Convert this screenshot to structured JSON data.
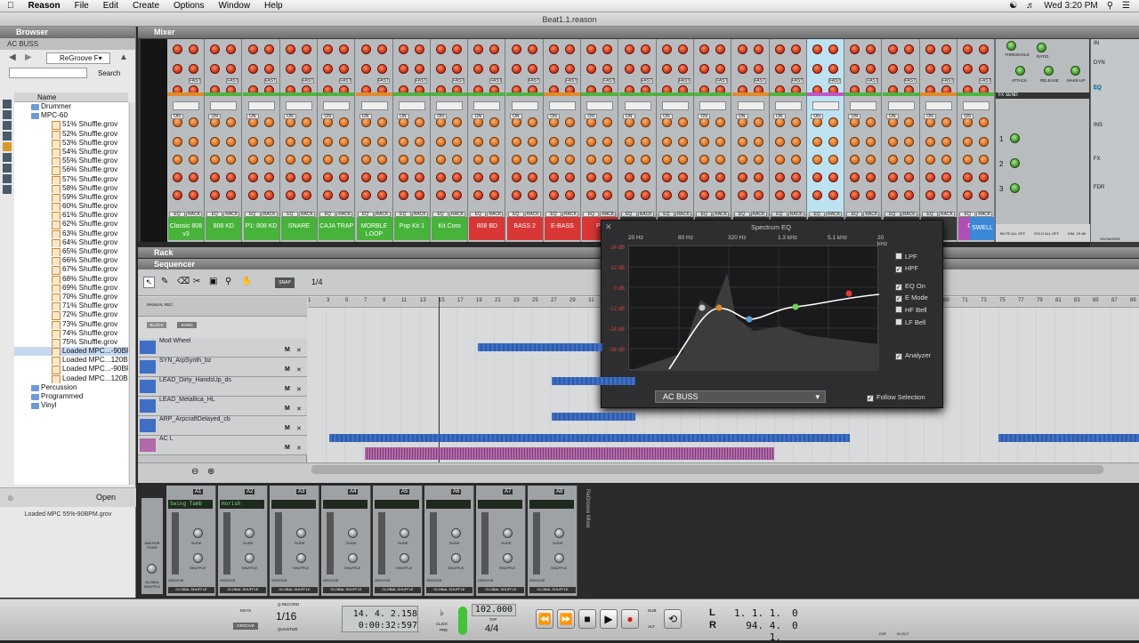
{
  "menubar": {
    "app": "Reason",
    "items": [
      "File",
      "Edit",
      "Create",
      "Options",
      "Window",
      "Help"
    ],
    "clock": "Wed 3:20 PM"
  },
  "window": {
    "title": "Beat1.1.reason"
  },
  "browser": {
    "title": "Browser",
    "location": "AC BUSS",
    "dropdown": "ReGroove F▾",
    "search_button": "Search",
    "column_name": "Name",
    "tree": [
      {
        "label": "Drummer",
        "kind": "folder"
      },
      {
        "label": "MPC-60",
        "kind": "folder"
      },
      {
        "label": "51% Shuffle.grov",
        "kind": "file"
      },
      {
        "label": "52% Shuffle.grov",
        "kind": "file"
      },
      {
        "label": "53% Shuffle.grov",
        "kind": "file"
      },
      {
        "label": "54% Shuffle.grov",
        "kind": "file"
      },
      {
        "label": "55% Shuffle.grov",
        "kind": "file"
      },
      {
        "label": "56% Shuffle.grov",
        "kind": "file"
      },
      {
        "label": "57% Shuffle.grov",
        "kind": "file"
      },
      {
        "label": "58% Shuffle.grov",
        "kind": "file"
      },
      {
        "label": "59% Shuffle.grov",
        "kind": "file"
      },
      {
        "label": "60% Shuffle.grov",
        "kind": "file"
      },
      {
        "label": "61% Shuffle.grov",
        "kind": "file"
      },
      {
        "label": "62% Shuffle.grov",
        "kind": "file"
      },
      {
        "label": "63% Shuffle.grov",
        "kind": "file"
      },
      {
        "label": "64% Shuffle.grov",
        "kind": "file"
      },
      {
        "label": "65% Shuffle.grov",
        "kind": "file"
      },
      {
        "label": "66% Shuffle.grov",
        "kind": "file"
      },
      {
        "label": "67% Shuffle.grov",
        "kind": "file"
      },
      {
        "label": "68% Shuffle.grov",
        "kind": "file"
      },
      {
        "label": "69% Shuffle.grov",
        "kind": "file"
      },
      {
        "label": "70% Shuffle.grov",
        "kind": "file"
      },
      {
        "label": "71% Shuffle.grov",
        "kind": "file"
      },
      {
        "label": "72% Shuffle.grov",
        "kind": "file"
      },
      {
        "label": "73% Shuffle.grov",
        "kind": "file"
      },
      {
        "label": "74% Shuffle.grov",
        "kind": "file"
      },
      {
        "label": "75% Shuffle.grov",
        "kind": "file"
      },
      {
        "label": "Loaded MPC...-90BPM.grov",
        "kind": "file",
        "selected": true
      },
      {
        "label": "Loaded MPC...120BPM.grov",
        "kind": "file"
      },
      {
        "label": "Loaded MPC...-90BPM.grov",
        "kind": "file"
      },
      {
        "label": "Loaded MPC...120BPM.grov",
        "kind": "file"
      },
      {
        "label": "Percussion",
        "kind": "folder"
      },
      {
        "label": "Programmed",
        "kind": "folder"
      },
      {
        "label": "Vinyl",
        "kind": "folder"
      }
    ],
    "open_button": "Open",
    "status": "Loaded MPC 55%-90BPM.grov"
  },
  "mixer": {
    "title": "Mixer",
    "channels": [
      {
        "name": "Classic 808 v3",
        "color": "#47b33a"
      },
      {
        "name": "808 KD",
        "color": "#47b33a"
      },
      {
        "name": "P1: 808 KD",
        "color": "#47b33a"
      },
      {
        "name": "SNARE",
        "color": "#47b33a"
      },
      {
        "name": "CAJA TRAP",
        "color": "#47b33a"
      },
      {
        "name": "MORBLE LOOP",
        "color": "#47b33a"
      },
      {
        "name": "Pop Kit 1",
        "color": "#47b33a"
      },
      {
        "name": "Kit Coro",
        "color": "#47b33a"
      },
      {
        "name": "808 BD",
        "color": "#d93636"
      },
      {
        "name": "BASS 2",
        "color": "#d93636"
      },
      {
        "name": "E-BASS",
        "color": "#d93636"
      },
      {
        "name": "P1",
        "color": "#d93636"
      },
      {
        "name": "",
        "color": "#3a3a3a"
      },
      {
        "name": "",
        "color": "#3a3a3a"
      },
      {
        "name": "",
        "color": "#3a3a3a"
      },
      {
        "name": "",
        "color": "#3a3a3a"
      },
      {
        "name": "",
        "color": "#3a3a3a"
      },
      {
        "name": "",
        "color": "#3a3a3a"
      },
      {
        "name": "",
        "color": "#3a3a3a"
      },
      {
        "name": "",
        "color": "#3a3a3a"
      },
      {
        "name": "",
        "color": "#3a3a3a"
      },
      {
        "name": "OPUS",
        "color": "#b04fb5"
      }
    ],
    "swell_label": "SWELL",
    "knob_labels": {
      "on": "ON",
      "fast": "FAST",
      "eq": "EQ",
      "rack": "RACK"
    },
    "master_labels": [
      "THRESHOLD",
      "RATIO",
      "ATTACK",
      "RELEASE",
      "MAKE-UP",
      "FX SEND"
    ],
    "side_tabs": [
      "IN",
      "DYN",
      "EQ",
      "INS",
      "FX",
      "FDR"
    ],
    "fx_rows": [
      "1",
      "2",
      "3"
    ],
    "bottom_labels": [
      "MUTE ALL OFF",
      "SOLO ALL OFF",
      "DIM -20 dB"
    ],
    "show_hide": "SHOW/HIDE"
  },
  "spectrum_eq": {
    "title": "Spectrum EQ",
    "freq_labels": [
      "20 Hz",
      "80 Hz",
      "320 Hz",
      "1.3 kHz",
      "5.1 kHz",
      "20 kHz"
    ],
    "db_labels": [
      "24 dB",
      "12 dB",
      "0 dB",
      "-12 dB",
      "-24 dB",
      "-36 dB"
    ],
    "options": [
      {
        "label": "LPF",
        "checked": false
      },
      {
        "label": "HPF",
        "checked": true
      },
      {
        "label": "EQ On",
        "checked": true
      },
      {
        "label": "E Mode",
        "checked": true
      },
      {
        "label": "HF Bell",
        "checked": false
      },
      {
        "label": "LF Bell",
        "checked": false
      },
      {
        "label": "Analyzer",
        "checked": true
      }
    ],
    "selected_channel": "AC BUSS",
    "follow_selection": "Follow Selection"
  },
  "rack": {
    "title": "Rack"
  },
  "sequencer": {
    "title": "Sequencer",
    "snap": "SNAP",
    "quantize": "1/4",
    "manual_rec": "MANUAL REC",
    "block": "BLOCK",
    "song": "SONG",
    "tracks": [
      {
        "name": "Mod Wheel"
      },
      {
        "name": "SYN_ArpSynth_bz"
      },
      {
        "name": "LEAD_Dirty_HandsUp_ds"
      },
      {
        "name": "LEAD_Metallica_HL"
      },
      {
        "name": "ARP_ArpcraftDelayed_cb"
      },
      {
        "name": "AC L"
      }
    ],
    "ruler": [
      "1",
      "3",
      "5",
      "7",
      "9",
      "11",
      "13",
      "15",
      "17",
      "19",
      "21",
      "23",
      "25",
      "27",
      "29",
      "31",
      "33",
      "35",
      "37",
      "39",
      "41",
      "43",
      "45",
      "47",
      "49",
      "51",
      "53",
      "55",
      "57",
      "59",
      "61",
      "63",
      "65",
      "67",
      "69",
      "71",
      "73",
      "75",
      "77",
      "79",
      "81",
      "83",
      "85",
      "87",
      "89"
    ]
  },
  "regroove": {
    "title": "ReGroove Mixer",
    "channels": [
      {
        "name": "A1",
        "groove": "Swing Tamb"
      },
      {
        "name": "A2",
        "groove": "Horish"
      },
      {
        "name": "A3",
        "groove": ""
      },
      {
        "name": "A4",
        "groove": ""
      },
      {
        "name": "A5",
        "groove": ""
      },
      {
        "name": "A6",
        "groove": ""
      },
      {
        "name": "A7",
        "groove": ""
      },
      {
        "name": "A8",
        "groove": ""
      }
    ],
    "knob_slide": "SLIDE",
    "knob_shuffle": "SHUFFLE",
    "global_shuffle": "GLOBAL SHUFFLE",
    "groove": "GROOVE",
    "anchor_point": "ANCHOR POINT"
  },
  "transport": {
    "keys": "KEYS",
    "groove": "GROOVE",
    "quantize_value": "1/16",
    "quantize_label": "QUANTIZE",
    "record_label": "Q RECORD",
    "position": "14.  4.  2.158",
    "time": "0:00:32:597",
    "click": "CLICK",
    "pre": "PRE",
    "tempo": "102.000",
    "tap": "TAP",
    "signature": "4/4",
    "dub": "DUB",
    "alt": "ALT",
    "loop_left_label": "L",
    "loop_right_label": "R",
    "loop_left": "1.  1.  1.",
    "loop_left_tick": "0",
    "loop_right": "94.  4.  1.",
    "loop_right_tick": "0",
    "dsp": "DSP",
    "in_out": "IN   OUT"
  },
  "colors": {
    "accent_blue": "#3e6fc4",
    "groove_pink": "#b06aa8",
    "record_red": "#d51b1b",
    "channel_green": "#47b33a"
  }
}
